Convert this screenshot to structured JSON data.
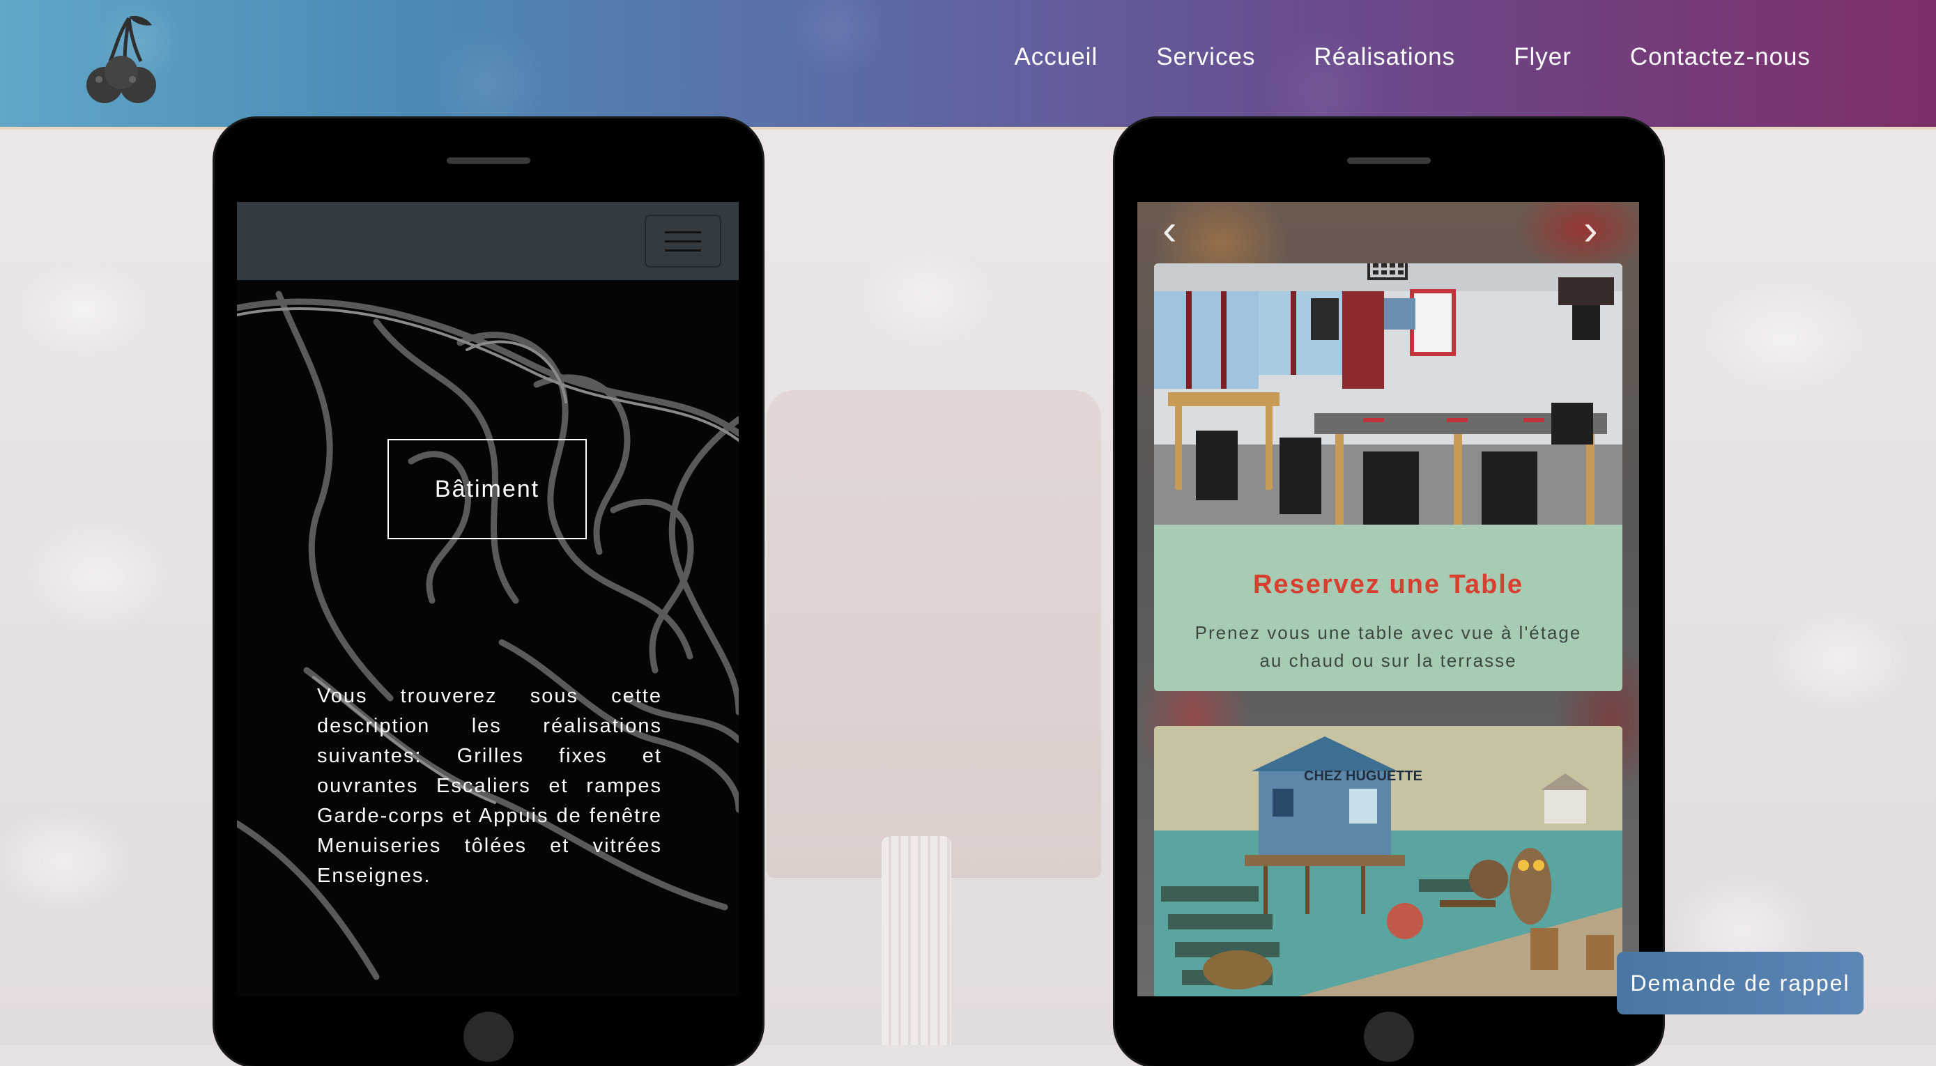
{
  "header": {
    "logo": "cherry-logo",
    "nav": [
      {
        "label": "Accueil"
      },
      {
        "label": "Services"
      },
      {
        "label": "Réalisations"
      },
      {
        "label": "Flyer"
      },
      {
        "label": "Contactez-nous"
      }
    ]
  },
  "left_phone": {
    "menu_icon": "hamburger-icon",
    "button_label": "Bâtiment",
    "description": "Vous trouverez sous cette description les réalisations suivantes: Grilles fixes et ouvrantes Escaliers et rampes Garde-corps et Appuis de fenêtre Menuiseries tôlées et vitrées Enseignes."
  },
  "right_phone": {
    "prev_arrow": "‹",
    "next_arrow": "›",
    "card_title": "Reservez une Table",
    "card_text_line1": "Prenez vous une table avec vue à l'étage",
    "card_text_line2": "au chaud ou sur la terrasse",
    "painting_sign": "CHEZ HUGUETTE"
  },
  "callback_button": "Demande de rappel",
  "colors": {
    "accent_red": "#d73f2f",
    "card_green": "#a8cbb4",
    "callback_blue": "#4a76a3"
  }
}
